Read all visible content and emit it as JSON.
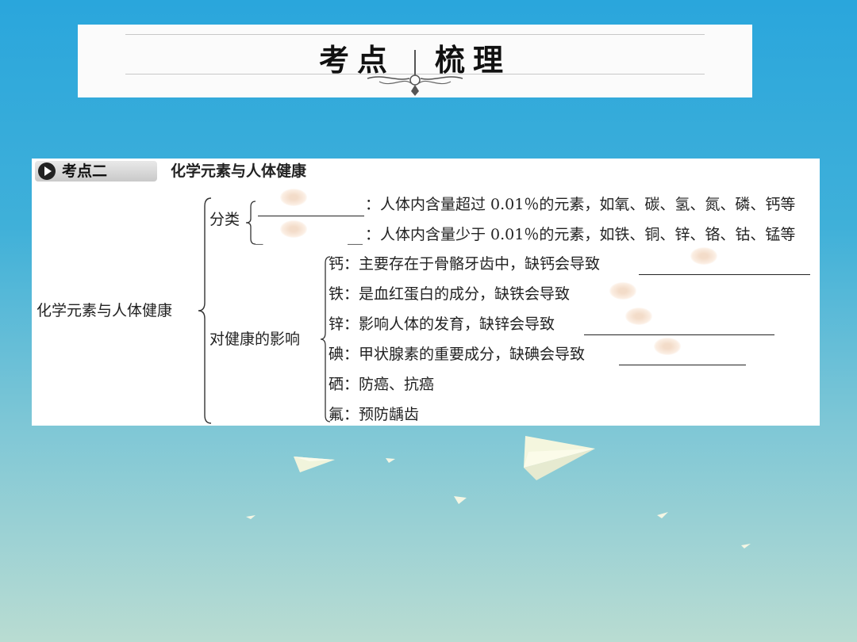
{
  "title": {
    "left": "考点",
    "right": "梳理"
  },
  "section": {
    "badge": "考点二",
    "heading": "化学元素与人体健康"
  },
  "root_label": "化学元素与人体健康",
  "classification": {
    "label": "分类",
    "row1": "：人体内含量超过 0.01％的元素，如氧、碳、氢、氮、磷、钙等",
    "row2_prefix": "_",
    "row2_mid": "__",
    "row2": "：人体内含量少于 0.01％的元素，如铁、铜、锌、铬、钴、锰等"
  },
  "health": {
    "label": "对健康的影响",
    "items": [
      "钙：主要存在于骨骼牙齿中，缺钙会导致",
      "铁：是血红蛋白的成分，缺铁会导致",
      "锌：影响人体的发育，缺锌会导致",
      "碘：甲状腺素的重要成分，缺碘会导致",
      "硒：防癌、抗癌",
      "氟：预防龋齿"
    ]
  }
}
